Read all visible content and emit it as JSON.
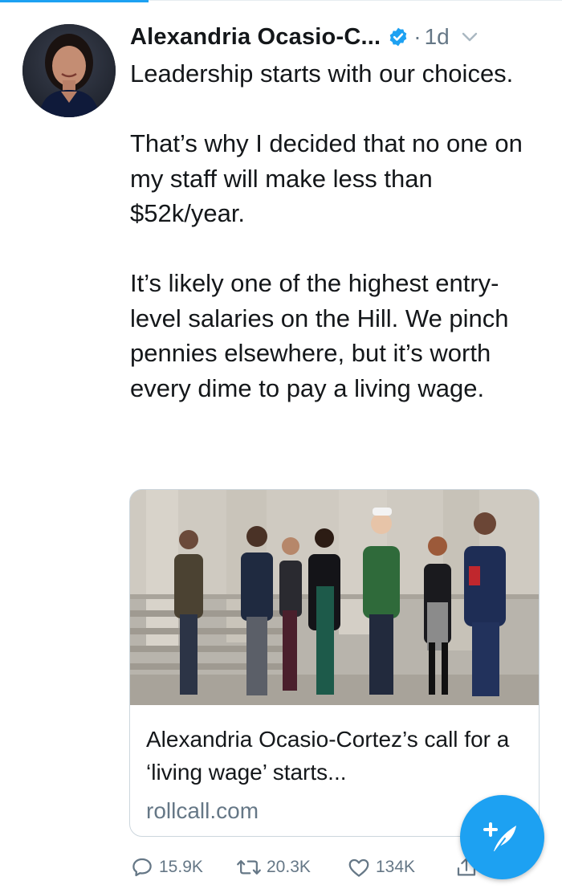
{
  "tweet": {
    "author_name": "Alexandria Ocasio-C...",
    "separator": "·",
    "timestamp": "1d",
    "text": "Leadership starts with our choices.\n\nThat’s why I decided that no one on my staff will make less than $52k/year.\n\nIt’s likely one of the highest entry-level salaries on the Hill. We pinch pennies elsewhere, but it’s worth every dime to pay a living wage."
  },
  "card": {
    "title": "Alexandria Ocasio-Cortez’s call for a ‘living wage’ starts...",
    "domain": "rollcall.com"
  },
  "actions": {
    "replies": "15.9K",
    "retweets": "20.3K",
    "likes": "134K"
  },
  "icons": {
    "verified": "verified-badge-icon",
    "menu": "chevron-down-icon",
    "reply": "reply-icon",
    "retweet": "retweet-icon",
    "like": "heart-icon",
    "share": "share-icon",
    "compose": "compose-tweet-icon"
  },
  "colors": {
    "accent": "#1da1f2",
    "text": "#14171a",
    "secondary": "#657786"
  }
}
